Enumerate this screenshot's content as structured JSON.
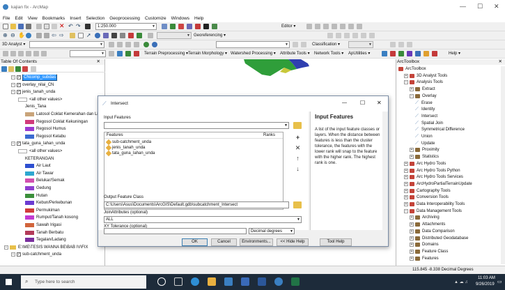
{
  "window": {
    "title": "kajian fix - ArcMap"
  },
  "menu": [
    "File",
    "Edit",
    "View",
    "Bookmarks",
    "Insert",
    "Selection",
    "Geoprocessing",
    "Customize",
    "Windows",
    "Help"
  ],
  "toolbar": {
    "scale": "1:250.000",
    "georeferencing": "Georeferencing ▾",
    "editor": "Editor ▾",
    "analyst": "3D Analyst ▾",
    "classification": "Classification ▾",
    "terrain_items": [
      "Terrain Preprocessing ▾",
      "Terrain Morphology ▾",
      "Watershed Processing ▾",
      "Attribute Tools ▾",
      "Network Tools ▾",
      "ApUtilities ▾",
      "Help ▾"
    ]
  },
  "toc": {
    "title": "Table Of Contents",
    "close": "✕",
    "rows": [
      {
        "label": "CNcomp_subdas",
        "indent": 1,
        "type": "layer",
        "selected": true
      },
      {
        "label": "overlay_nilai_CN",
        "indent": 1,
        "type": "layer"
      },
      {
        "label": "jenis_tanah_unda",
        "indent": 1,
        "type": "layer"
      },
      {
        "label": "<all other values>",
        "indent": 2,
        "type": "sym",
        "color": "#ffffff"
      },
      {
        "label": "Jenis_Tana",
        "indent": 3,
        "type": "text"
      },
      {
        "label": "Latosol Coklat Kemerahan dan Litosol",
        "indent": 3,
        "type": "sym",
        "color": "#c9a47a"
      },
      {
        "label": "Regosol Coklat Kekuningan",
        "indent": 3,
        "type": "sym",
        "color": "#d13b7b"
      },
      {
        "label": "Regosol Humus",
        "indent": 3,
        "type": "sym",
        "color": "#9b3bd1"
      },
      {
        "label": "Regosol Kelabu",
        "indent": 3,
        "type": "sym",
        "color": "#3b6bd1"
      },
      {
        "label": "tata_guna_lahan_unda",
        "indent": 1,
        "type": "layer"
      },
      {
        "label": "<all other values>",
        "indent": 2,
        "type": "sym",
        "color": "#ffffff"
      },
      {
        "label": "KETERANGAN",
        "indent": 3,
        "type": "text"
      },
      {
        "label": "Air Laut",
        "indent": 3,
        "type": "sym",
        "color": "#2e4fd0"
      },
      {
        "label": "Air Tawar",
        "indent": 3,
        "type": "sym",
        "color": "#2ea7d0"
      },
      {
        "label": "Belukar/Semak",
        "indent": 3,
        "type": "sym",
        "color": "#d14fb0"
      },
      {
        "label": "Gedung",
        "indent": 3,
        "type": "sym",
        "color": "#8e3fd0"
      },
      {
        "label": "Hutan",
        "indent": 3,
        "type": "sym",
        "color": "#3b8f3b"
      },
      {
        "label": "Kebun/Perkebunan",
        "indent": 3,
        "type": "sym",
        "color": "#6b3bd1"
      },
      {
        "label": "Permukiman",
        "indent": 3,
        "type": "sym",
        "color": "#d13b3b"
      },
      {
        "label": "Rumput/Tanah kosong",
        "indent": 3,
        "type": "sym",
        "color": "#c23bd1"
      },
      {
        "label": "Sawah Irigasi",
        "indent": 3,
        "type": "sym",
        "color": "#d1643b"
      },
      {
        "label": "Tanah Berbatu",
        "indent": 3,
        "type": "sym",
        "color": "#b23b5a"
      },
      {
        "label": "Tegalan/Ladang",
        "indent": 3,
        "type": "sym",
        "color": "#7a2f9e"
      },
      {
        "label": "E:\\ME\\TESIS WANNA BE\\BAB IV\\FIX",
        "indent": 0,
        "type": "folder"
      },
      {
        "label": "sub-catchment_unda",
        "indent": 1,
        "type": "layer"
      }
    ]
  },
  "arctoolbox": {
    "title": "ArcToolbox",
    "close": "✕",
    "rows": [
      {
        "label": "ArcToolbox",
        "indent": 0,
        "kind": "root"
      },
      {
        "label": "3D Analyst Tools",
        "indent": 1,
        "kind": "box",
        "exp": "+"
      },
      {
        "label": "Analysis Tools",
        "indent": 1,
        "kind": "box",
        "exp": "-"
      },
      {
        "label": "Extract",
        "indent": 2,
        "kind": "set",
        "exp": "+"
      },
      {
        "label": "Overlay",
        "indent": 2,
        "kind": "set",
        "exp": "-"
      },
      {
        "label": "Erase",
        "indent": 3,
        "kind": "tool"
      },
      {
        "label": "Identity",
        "indent": 3,
        "kind": "tool"
      },
      {
        "label": "Intersect",
        "indent": 3,
        "kind": "tool"
      },
      {
        "label": "Spatial Join",
        "indent": 3,
        "kind": "tool"
      },
      {
        "label": "Symmetrical Difference",
        "indent": 3,
        "kind": "tool"
      },
      {
        "label": "Union",
        "indent": 3,
        "kind": "tool"
      },
      {
        "label": "Update",
        "indent": 3,
        "kind": "tool"
      },
      {
        "label": "Proximity",
        "indent": 2,
        "kind": "set",
        "exp": "+"
      },
      {
        "label": "Statistics",
        "indent": 2,
        "kind": "set",
        "exp": "+"
      },
      {
        "label": "Arc Hydro Tools",
        "indent": 1,
        "kind": "box",
        "exp": "+"
      },
      {
        "label": "Arc Hydro Tools Python",
        "indent": 1,
        "kind": "box",
        "exp": "+"
      },
      {
        "label": "Arc Hydro Tools Services",
        "indent": 1,
        "kind": "box",
        "exp": "+"
      },
      {
        "label": "ArcHydroPartialTerrainUpdate",
        "indent": 1,
        "kind": "box",
        "exp": "+"
      },
      {
        "label": "Cartography Tools",
        "indent": 1,
        "kind": "box",
        "exp": "+"
      },
      {
        "label": "Conversion Tools",
        "indent": 1,
        "kind": "box",
        "exp": "+"
      },
      {
        "label": "Data Interoperability Tools",
        "indent": 1,
        "kind": "box",
        "exp": "+"
      },
      {
        "label": "Data Management Tools",
        "indent": 1,
        "kind": "box",
        "exp": "-"
      },
      {
        "label": "Archiving",
        "indent": 2,
        "kind": "set",
        "exp": "+"
      },
      {
        "label": "Attachments",
        "indent": 2,
        "kind": "set",
        "exp": "+"
      },
      {
        "label": "Data Comparison",
        "indent": 2,
        "kind": "set",
        "exp": "+"
      },
      {
        "label": "Distributed Geodatabase",
        "indent": 2,
        "kind": "set",
        "exp": "+"
      },
      {
        "label": "Domains",
        "indent": 2,
        "kind": "set",
        "exp": "+"
      },
      {
        "label": "Feature Class",
        "indent": 2,
        "kind": "set",
        "exp": "+"
      },
      {
        "label": "Features",
        "indent": 2,
        "kind": "set",
        "exp": "+"
      }
    ]
  },
  "dialog": {
    "title": "Intersect",
    "minimize": "—",
    "maximize": "☐",
    "close": "✕",
    "input_features_label": "Input Features",
    "input_value": "",
    "features_header": "Features",
    "ranks_header": "Ranks",
    "features": [
      "sub-catchment_unda",
      "jenis_tanah_unda",
      "tata_guna_lahan_unda"
    ],
    "output_label": "Output Feature Class",
    "output_value": "C:\\Users\\Asus\\Documents\\ArcGIS\\Default.gdb\\subcatchment_Intersect",
    "join_label": "JoinAttributes (optional)",
    "join_value": "ALL",
    "xy_label": "XY Tolerance (optional)",
    "xy_value": "",
    "xy_unit": "Decimal degrees",
    "buttons": {
      "ok": "OK",
      "cancel": "Cancel",
      "environments": "Environments...",
      "hide_help": "<< Hide Help",
      "tool_help": "Tool Help"
    },
    "help_title": "Input Features",
    "help_text": "A list of the input feature classes or layers. When the distance between features is less than the cluster tolerance, the features with the lower rank will snap to the feature with the higher rank. The highest rank is one."
  },
  "status": {
    "coords": "115.845  -8.338 Decimal Degrees"
  },
  "taskbar": {
    "search_placeholder": "Type here to search",
    "time": "11:03 AM",
    "date": "9/26/2019"
  }
}
